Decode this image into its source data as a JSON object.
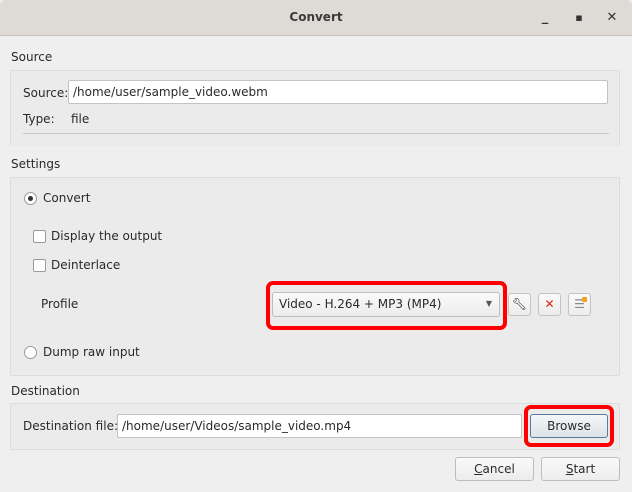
{
  "window": {
    "title": "Convert"
  },
  "source": {
    "section_label": "Source",
    "source_label": "Source:",
    "source_value": "/home/user/sample_video.webm",
    "type_label": "Type:",
    "type_value": "file"
  },
  "settings": {
    "section_label": "Settings",
    "convert_label": "Convert",
    "display_output_label": "Display the output",
    "deinterlace_label": "Deinterlace",
    "profile_label": "Profile",
    "profile_value": "Video - H.264 + MP3 (MP4)",
    "dump_raw_label": "Dump raw input",
    "convert_selected": true,
    "display_output_checked": false,
    "deinterlace_checked": false
  },
  "destination": {
    "section_label": "Destination",
    "file_label": "Destination file:",
    "file_value": "/home/user/Videos/sample_video.mp4",
    "browse_label": "Browse"
  },
  "buttons": {
    "cancel_first": "C",
    "cancel_rest": "ancel",
    "start_first": "S",
    "start_rest": "tart"
  },
  "colors": {
    "highlight": "#ff0000",
    "delete_icon": "#e0201b"
  }
}
